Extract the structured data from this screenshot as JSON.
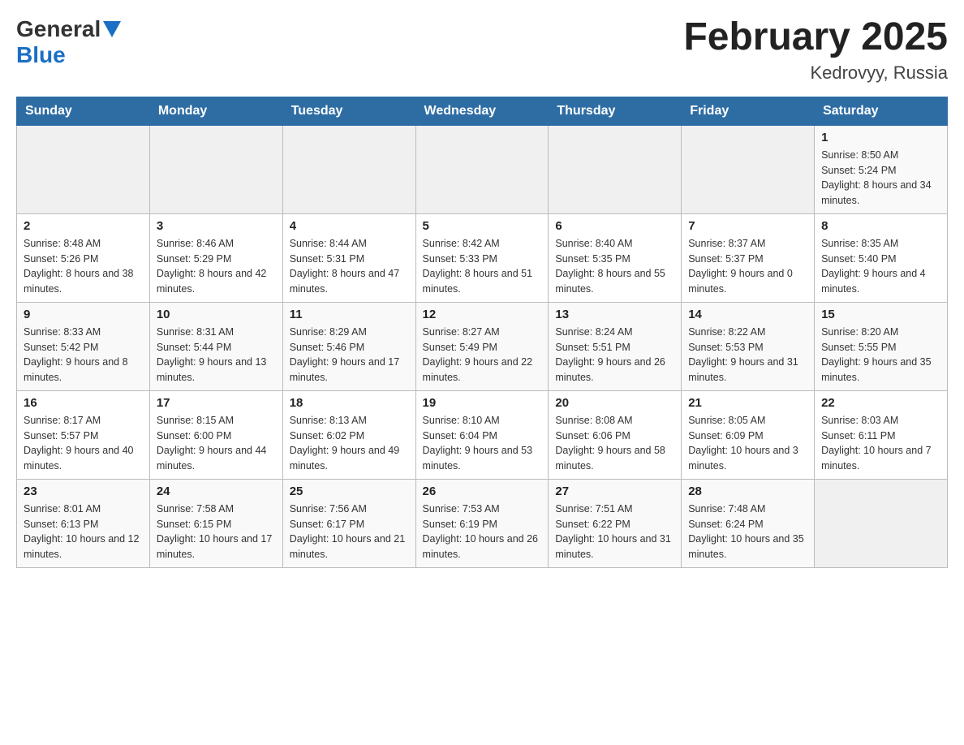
{
  "header": {
    "logo_general": "General",
    "logo_blue": "Blue",
    "month_title": "February 2025",
    "location": "Kedrovyy, Russia"
  },
  "calendar": {
    "days_of_week": [
      "Sunday",
      "Monday",
      "Tuesday",
      "Wednesday",
      "Thursday",
      "Friday",
      "Saturday"
    ],
    "weeks": [
      [
        {
          "day": "",
          "info": ""
        },
        {
          "day": "",
          "info": ""
        },
        {
          "day": "",
          "info": ""
        },
        {
          "day": "",
          "info": ""
        },
        {
          "day": "",
          "info": ""
        },
        {
          "day": "",
          "info": ""
        },
        {
          "day": "1",
          "info": "Sunrise: 8:50 AM\nSunset: 5:24 PM\nDaylight: 8 hours and 34 minutes."
        }
      ],
      [
        {
          "day": "2",
          "info": "Sunrise: 8:48 AM\nSunset: 5:26 PM\nDaylight: 8 hours and 38 minutes."
        },
        {
          "day": "3",
          "info": "Sunrise: 8:46 AM\nSunset: 5:29 PM\nDaylight: 8 hours and 42 minutes."
        },
        {
          "day": "4",
          "info": "Sunrise: 8:44 AM\nSunset: 5:31 PM\nDaylight: 8 hours and 47 minutes."
        },
        {
          "day": "5",
          "info": "Sunrise: 8:42 AM\nSunset: 5:33 PM\nDaylight: 8 hours and 51 minutes."
        },
        {
          "day": "6",
          "info": "Sunrise: 8:40 AM\nSunset: 5:35 PM\nDaylight: 8 hours and 55 minutes."
        },
        {
          "day": "7",
          "info": "Sunrise: 8:37 AM\nSunset: 5:37 PM\nDaylight: 9 hours and 0 minutes."
        },
        {
          "day": "8",
          "info": "Sunrise: 8:35 AM\nSunset: 5:40 PM\nDaylight: 9 hours and 4 minutes."
        }
      ],
      [
        {
          "day": "9",
          "info": "Sunrise: 8:33 AM\nSunset: 5:42 PM\nDaylight: 9 hours and 8 minutes."
        },
        {
          "day": "10",
          "info": "Sunrise: 8:31 AM\nSunset: 5:44 PM\nDaylight: 9 hours and 13 minutes."
        },
        {
          "day": "11",
          "info": "Sunrise: 8:29 AM\nSunset: 5:46 PM\nDaylight: 9 hours and 17 minutes."
        },
        {
          "day": "12",
          "info": "Sunrise: 8:27 AM\nSunset: 5:49 PM\nDaylight: 9 hours and 22 minutes."
        },
        {
          "day": "13",
          "info": "Sunrise: 8:24 AM\nSunset: 5:51 PM\nDaylight: 9 hours and 26 minutes."
        },
        {
          "day": "14",
          "info": "Sunrise: 8:22 AM\nSunset: 5:53 PM\nDaylight: 9 hours and 31 minutes."
        },
        {
          "day": "15",
          "info": "Sunrise: 8:20 AM\nSunset: 5:55 PM\nDaylight: 9 hours and 35 minutes."
        }
      ],
      [
        {
          "day": "16",
          "info": "Sunrise: 8:17 AM\nSunset: 5:57 PM\nDaylight: 9 hours and 40 minutes."
        },
        {
          "day": "17",
          "info": "Sunrise: 8:15 AM\nSunset: 6:00 PM\nDaylight: 9 hours and 44 minutes."
        },
        {
          "day": "18",
          "info": "Sunrise: 8:13 AM\nSunset: 6:02 PM\nDaylight: 9 hours and 49 minutes."
        },
        {
          "day": "19",
          "info": "Sunrise: 8:10 AM\nSunset: 6:04 PM\nDaylight: 9 hours and 53 minutes."
        },
        {
          "day": "20",
          "info": "Sunrise: 8:08 AM\nSunset: 6:06 PM\nDaylight: 9 hours and 58 minutes."
        },
        {
          "day": "21",
          "info": "Sunrise: 8:05 AM\nSunset: 6:09 PM\nDaylight: 10 hours and 3 minutes."
        },
        {
          "day": "22",
          "info": "Sunrise: 8:03 AM\nSunset: 6:11 PM\nDaylight: 10 hours and 7 minutes."
        }
      ],
      [
        {
          "day": "23",
          "info": "Sunrise: 8:01 AM\nSunset: 6:13 PM\nDaylight: 10 hours and 12 minutes."
        },
        {
          "day": "24",
          "info": "Sunrise: 7:58 AM\nSunset: 6:15 PM\nDaylight: 10 hours and 17 minutes."
        },
        {
          "day": "25",
          "info": "Sunrise: 7:56 AM\nSunset: 6:17 PM\nDaylight: 10 hours and 21 minutes."
        },
        {
          "day": "26",
          "info": "Sunrise: 7:53 AM\nSunset: 6:19 PM\nDaylight: 10 hours and 26 minutes."
        },
        {
          "day": "27",
          "info": "Sunrise: 7:51 AM\nSunset: 6:22 PM\nDaylight: 10 hours and 31 minutes."
        },
        {
          "day": "28",
          "info": "Sunrise: 7:48 AM\nSunset: 6:24 PM\nDaylight: 10 hours and 35 minutes."
        },
        {
          "day": "",
          "info": ""
        }
      ]
    ]
  }
}
